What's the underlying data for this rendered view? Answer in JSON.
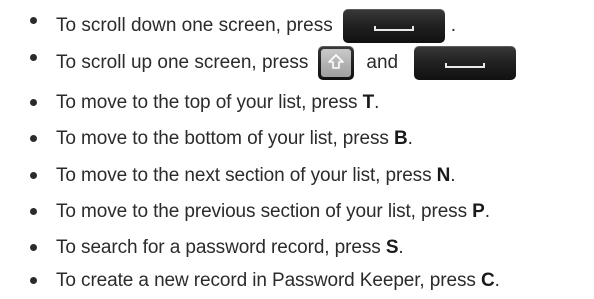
{
  "instructions": [
    {
      "prefix": "To scroll down one screen, press",
      "suffix": ".",
      "key": ""
    },
    {
      "prefix": "To scroll up one screen, press",
      "connector": "and",
      "key": ""
    },
    {
      "prefix": "To move to the top of your list, press ",
      "key": "T",
      "suffix": "."
    },
    {
      "prefix": "To move to the bottom of your list, press ",
      "key": "B",
      "suffix": "."
    },
    {
      "prefix": "To move to the next section of your list, press ",
      "key": "N",
      "suffix": "."
    },
    {
      "prefix": "To move to the previous section of your list, press ",
      "key": "P",
      "suffix": "."
    },
    {
      "prefix": "To search for a password record, press ",
      "key": "S",
      "suffix": "."
    },
    {
      "prefix": "To create a new record in Password Keeper, press ",
      "key": "C",
      "suffix": "."
    }
  ],
  "icons": {
    "space_key": "space-key-icon",
    "shift_key": "shift-key-icon"
  },
  "colors": {
    "text": "#2b2b2b",
    "key_dark": "#1a1a1a",
    "shift_tile": "#b4b4b4"
  }
}
